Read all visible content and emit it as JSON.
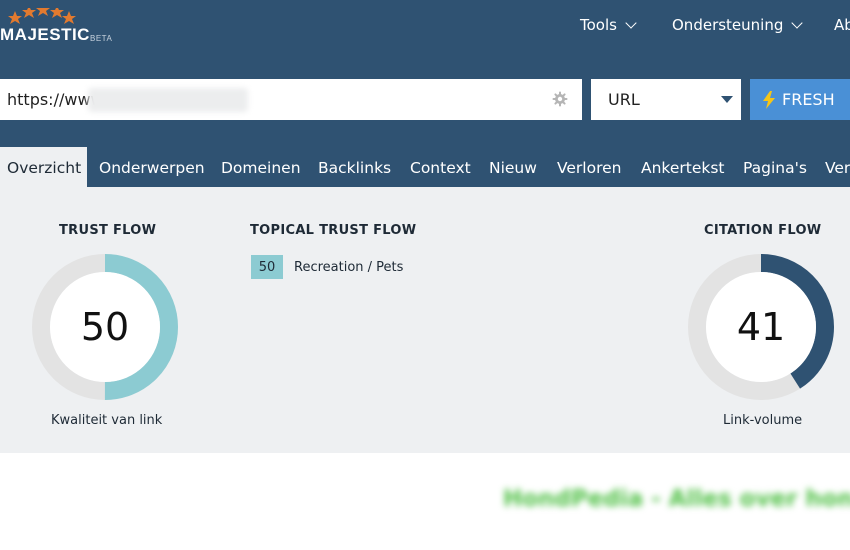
{
  "header": {
    "logo_text": "MAJESTIC",
    "logo_badge": "BETA",
    "nav": [
      {
        "label": "Tools"
      },
      {
        "label": "Ondersteuning"
      },
      {
        "label": "Ab"
      }
    ]
  },
  "search": {
    "url_value": "https://www",
    "type_selected": "URL",
    "fresh_label": "FRESH"
  },
  "tabs": [
    {
      "label": "Overzicht",
      "active": true
    },
    {
      "label": "Onderwerpen"
    },
    {
      "label": "Domeinen"
    },
    {
      "label": "Backlinks"
    },
    {
      "label": "Context"
    },
    {
      "label": "Nieuw"
    },
    {
      "label": "Verloren"
    },
    {
      "label": "Ankertekst"
    },
    {
      "label": "Pagina's"
    },
    {
      "label": "Ver"
    }
  ],
  "metrics": {
    "trust_flow": {
      "title": "TRUST FLOW",
      "value": "50",
      "fraction": 0.5,
      "caption": "Kwaliteit van link",
      "color": "#8ccbd2"
    },
    "topical_trust_flow": {
      "title": "TOPICAL TRUST FLOW",
      "items": [
        {
          "score": "50",
          "topic": "Recreation / Pets"
        }
      ]
    },
    "citation_flow": {
      "title": "CITATION FLOW",
      "value": "41",
      "fraction": 0.41,
      "caption": "Link-volume",
      "color": "#2f5272"
    }
  },
  "page_heading": "HondPedia - Alles over hon",
  "colors": {
    "header_bg": "#2f5272",
    "panel_bg": "#eef0f2",
    "fresh_bg": "#4a90d6",
    "gauge_track": "#e3e3e3"
  }
}
